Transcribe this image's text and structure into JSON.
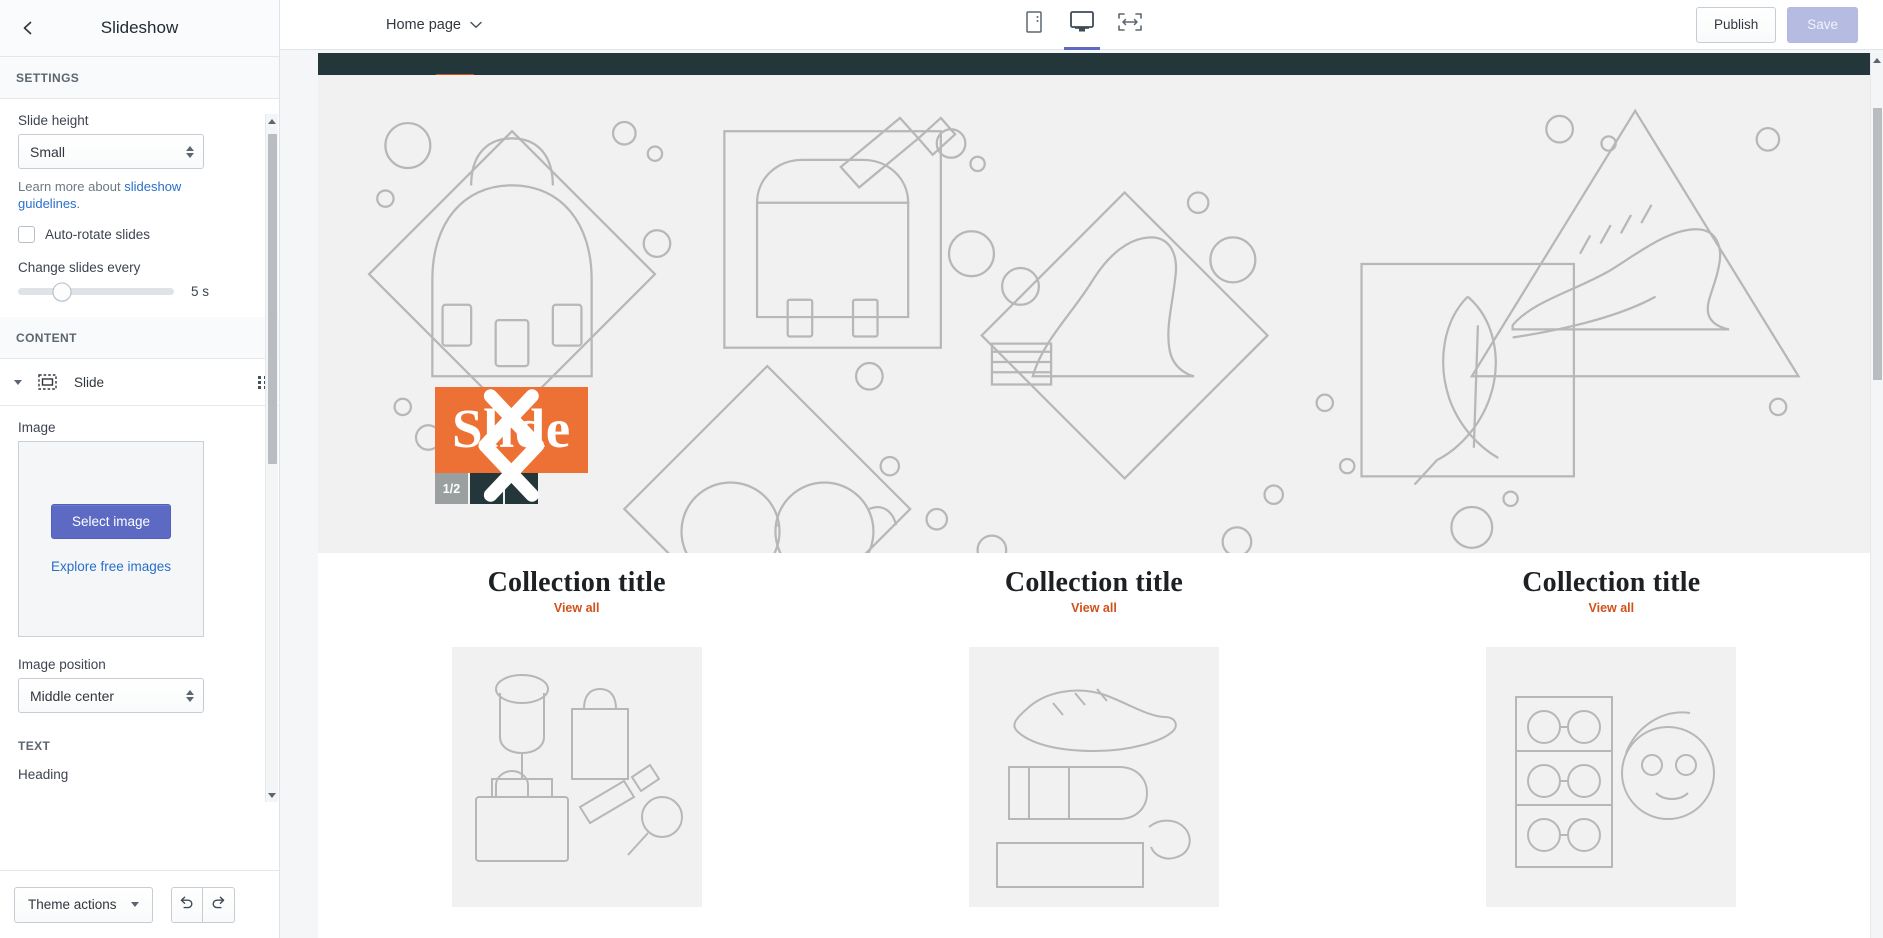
{
  "sidebar": {
    "back_icon": "chevron-left-icon",
    "title": "Slideshow",
    "settings": {
      "header": "SETTINGS",
      "slide_height_label": "Slide height",
      "slide_height_value": "Small",
      "help_prefix": "Learn more about ",
      "help_link": "slideshow guidelines",
      "help_suffix": ".",
      "autorotate_label": "Auto-rotate slides",
      "autorotate_checked": false,
      "change_every_label": "Change slides every",
      "change_every_value": "5 s"
    },
    "content": {
      "header": "CONTENT",
      "slide_item_label": "Slide",
      "slide_item_icon": "slideshow-block-icon",
      "drag_handle_icon": "drag-handle-icon",
      "image_label": "Image",
      "select_image_button": "Select image",
      "explore_link": "Explore free images",
      "image_position_label": "Image position",
      "image_position_value": "Middle center"
    },
    "text_section": {
      "header": "TEXT",
      "heading_label": "Heading"
    },
    "footer": {
      "theme_actions_label": "Theme actions",
      "undo_icon": "undo-icon",
      "redo_icon": "redo-icon"
    }
  },
  "topbar": {
    "page_selector": "Home page",
    "page_selector_icon": "chevron-down-icon",
    "devices": [
      {
        "name": "mobile-view",
        "icon": "mobile-icon",
        "active": false
      },
      {
        "name": "desktop-view",
        "icon": "desktop-icon",
        "active": true
      },
      {
        "name": "fullwidth-view",
        "icon": "full-width-icon",
        "active": false
      }
    ],
    "publish_label": "Publish",
    "save_label": "Save",
    "save_disabled": true
  },
  "preview": {
    "hero": {
      "slide_title": "Slide",
      "counter": "1/2",
      "prev_icon": "chevron-left-icon",
      "next_icon": "chevron-right-icon"
    },
    "collections": [
      {
        "title": "Collection title",
        "view_all": "View all"
      },
      {
        "title": "Collection title",
        "view_all": "View all"
      },
      {
        "title": "Collection title",
        "view_all": "View all"
      }
    ]
  },
  "colors": {
    "accent_orange": "#ed7134",
    "link_orange": "#d1521a",
    "dark_teal": "#23373b",
    "primary_purple": "#5c6ac4",
    "link_blue": "#2a6fc9"
  }
}
